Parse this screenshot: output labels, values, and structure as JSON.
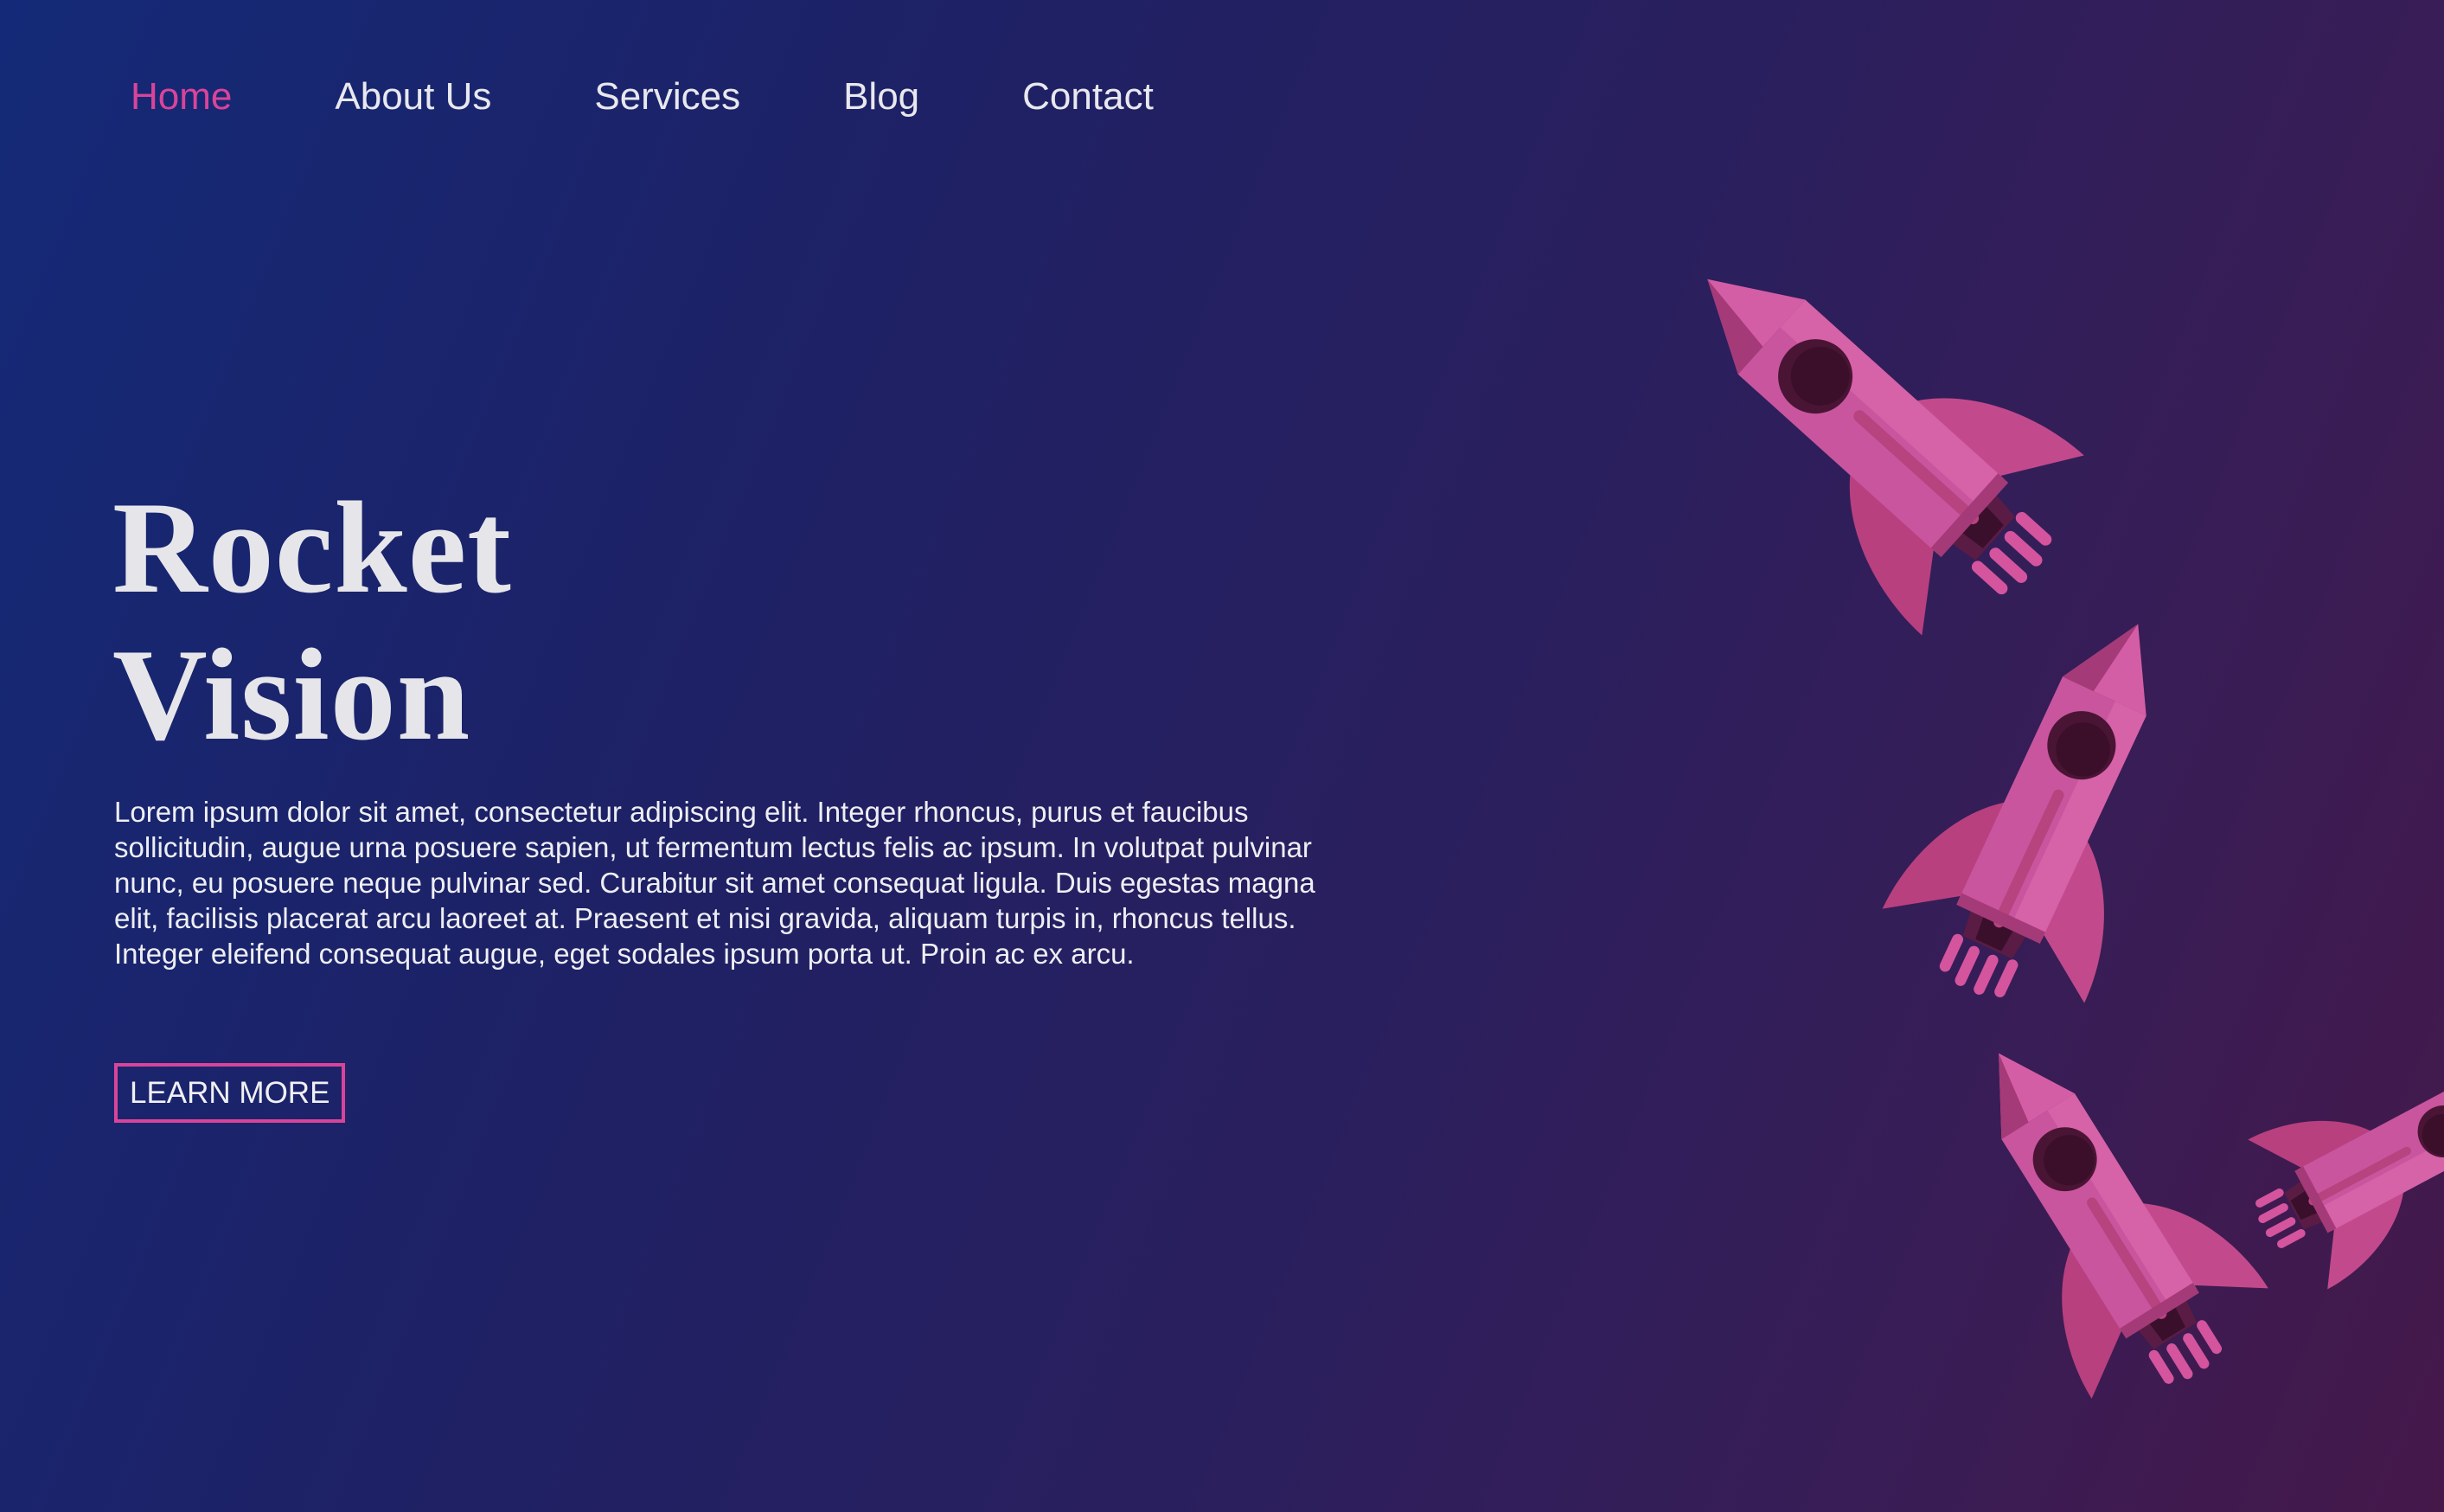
{
  "nav": {
    "items": [
      {
        "label": "Home",
        "active": true
      },
      {
        "label": "About Us",
        "active": false
      },
      {
        "label": "Services",
        "active": false
      },
      {
        "label": "Blog",
        "active": false
      },
      {
        "label": "Contact",
        "active": false
      }
    ]
  },
  "hero": {
    "title_line1": "Rocket",
    "title_line2": "Vision",
    "body": "Lorem ipsum dolor sit amet, consectetur adipiscing elit. Integer rhoncus, purus et faucibus sollicitudin, augue urna posuere sapien, ut fermentum lectus felis ac ipsum. In volutpat pulvinar nunc, eu posuere neque pulvinar sed. Curabitur sit amet consequat ligula. Duis egestas magna elit, facilisis placerat arcu laoreet at. Praesent et nisi gravida, aliquam turpis in, rhoncus tellus. Integer eleifend consequat augue, eget sodales ipsum porta ut. Proin ac ex arcu.",
    "cta_label": "LEARN MORE"
  },
  "illustration": {
    "icon": "rocket-icon",
    "count": 4
  },
  "colors": {
    "accent": "#d9449a",
    "rocket_body": "#c9559e",
    "rocket_fin": "#b8407f",
    "rocket_window": "#4a1535",
    "background_start": "#142a78",
    "background_end": "#45184a"
  }
}
